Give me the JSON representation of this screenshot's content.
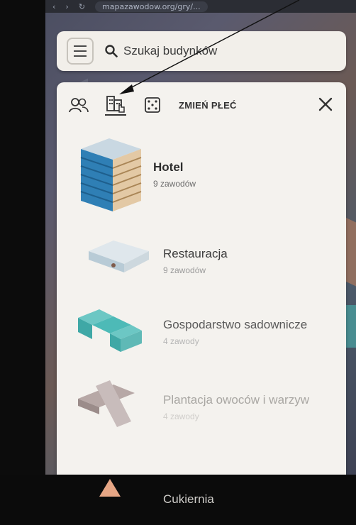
{
  "browser": {
    "url": "mapazawodow.org/gry/..."
  },
  "search": {
    "placeholder": "Szukaj budynków"
  },
  "panel": {
    "toolbar": {
      "people_icon": "people-icon",
      "buildings_icon": "buildings-icon",
      "dice_icon": "dice-icon",
      "change_sex_label": "ZMIEŃ PŁEĆ",
      "close_icon": "close-icon"
    },
    "items": [
      {
        "title": "Hotel",
        "subtitle": "9 zawodów"
      },
      {
        "title": "Restauracja",
        "subtitle": "9 zawodów"
      },
      {
        "title": "Gospodarstwo sadownicze",
        "subtitle": "4 zawody"
      },
      {
        "title": "Plantacja owoców i warzyw",
        "subtitle": "4 zawody"
      },
      {
        "title": "Cukiernia",
        "subtitle": ""
      }
    ]
  },
  "colors": {
    "panel_bg": "#f4f2ee",
    "text_primary": "#2d2d2d",
    "hotel_blue": "#2f7fb5",
    "teal_building": "#3fa8a6"
  }
}
